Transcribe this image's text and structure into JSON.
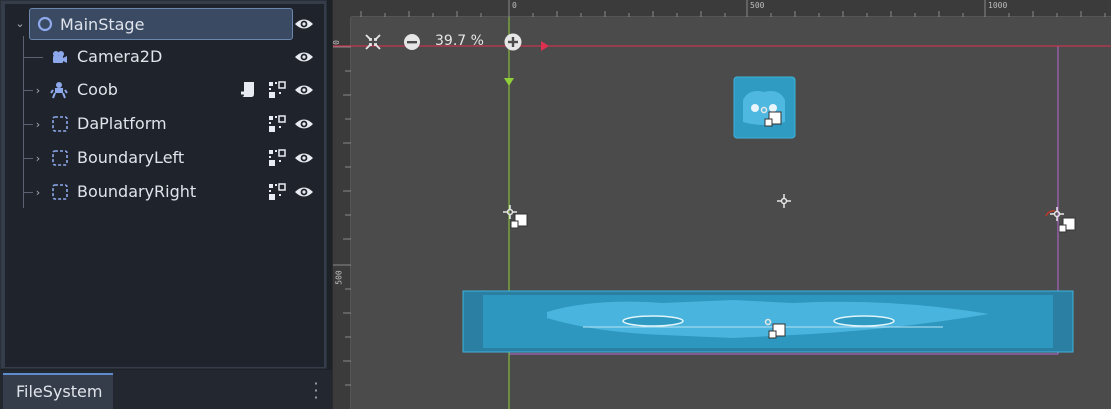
{
  "scene_tree": {
    "nodes": [
      {
        "label": "MainStage",
        "icon": "node2d-icon"
      },
      {
        "label": "Camera2D",
        "icon": "camera2d-icon"
      },
      {
        "label": "Coob",
        "icon": "character-body-icon"
      },
      {
        "label": "DaPlatform",
        "icon": "static-body-icon"
      },
      {
        "label": "BoundaryLeft",
        "icon": "static-body-icon"
      },
      {
        "label": "BoundaryRight",
        "icon": "static-body-icon"
      }
    ]
  },
  "dock": {
    "tab_label": "FileSystem",
    "menu_icon": "vertical-ellipsis-icon"
  },
  "viewport": {
    "zoom_label": "39.7 %",
    "ruler_top_labels": [
      "0",
      "500",
      "1000"
    ],
    "ruler_left_labels": [
      "0",
      "500"
    ]
  },
  "colors": {
    "selection": "#3a4a63",
    "accent": "#5f8ccf",
    "x_axis": "#e0304f",
    "y_axis": "#8fcf3a",
    "viewport_rect": "#b56ad6",
    "sprite": "#2f9ac2"
  }
}
